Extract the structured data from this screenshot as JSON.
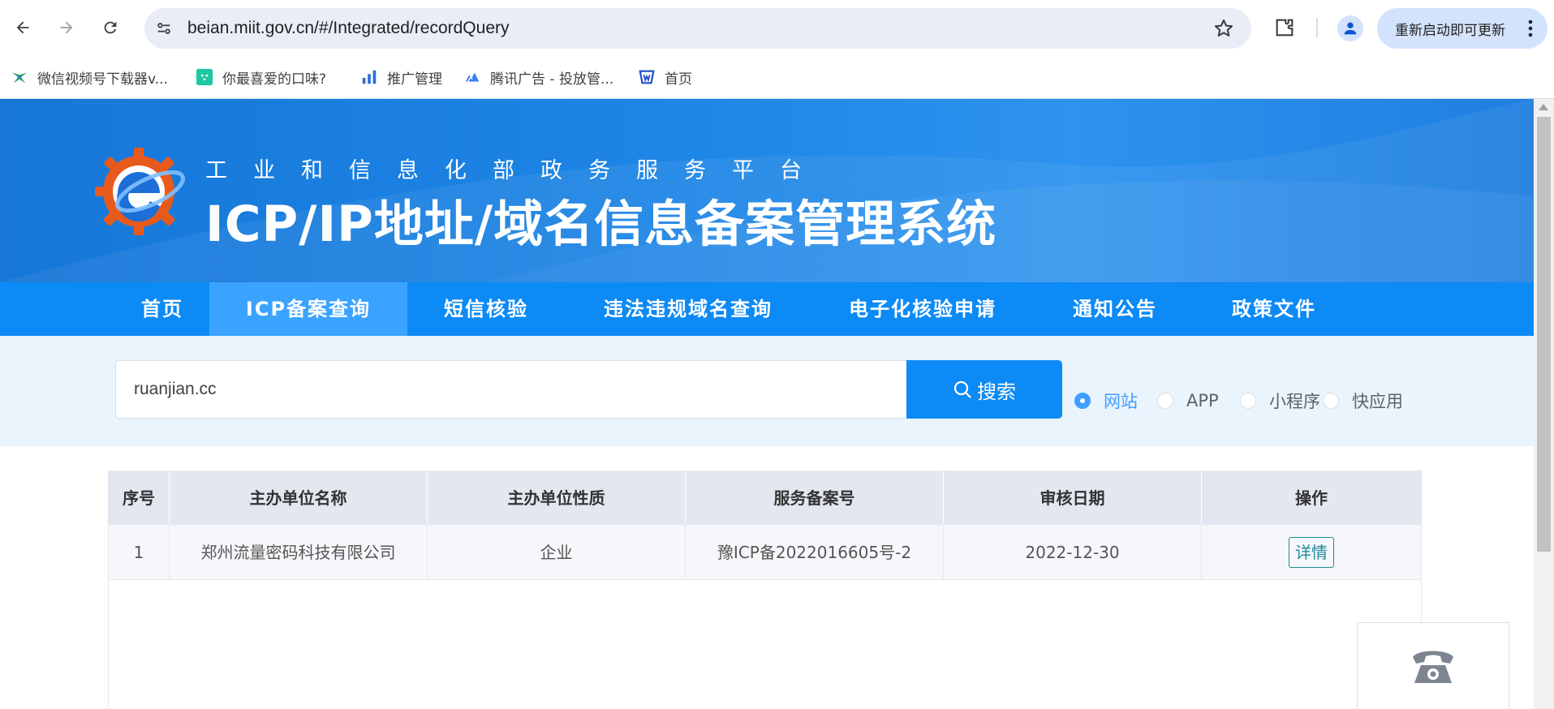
{
  "browser": {
    "url": "beian.miit.gov.cn/#/Integrated/recordQuery",
    "update_label": "重新启动即可更新",
    "bookmarks": [
      {
        "label": "微信视频号下载器v..."
      },
      {
        "label": "你最喜爱的口味?"
      },
      {
        "label": "推广管理"
      },
      {
        "label": "腾讯广告 - 投放管..."
      },
      {
        "label": "首页"
      }
    ]
  },
  "banner": {
    "subtitle": "工业和信息化部政务服务平台",
    "title": "ICP/IP地址/域名信息备案管理系统"
  },
  "nav": {
    "items": [
      {
        "label": "首页"
      },
      {
        "label": "ICP备案查询",
        "active": true
      },
      {
        "label": "短信核验"
      },
      {
        "label": "违法违规域名查询"
      },
      {
        "label": "电子化核验申请"
      },
      {
        "label": "通知公告"
      },
      {
        "label": "政策文件"
      }
    ]
  },
  "search": {
    "value": "ruanjian.cc",
    "button_label": "搜索",
    "types": [
      {
        "label": "网站",
        "checked": true
      },
      {
        "label": "APP"
      },
      {
        "label": "小程序"
      },
      {
        "label": "快应用"
      }
    ]
  },
  "table": {
    "headers": [
      "序号",
      "主办单位名称",
      "主办单位性质",
      "服务备案号",
      "审核日期",
      "操作"
    ],
    "rows": [
      {
        "index": "1",
        "org_name": "郑州流量密码科技有限公司",
        "org_type": "企业",
        "record_no": "豫ICP备2022016605号-2",
        "audit_date": "2022-12-30",
        "action": "详情"
      }
    ]
  },
  "colors": {
    "nav_bg": "#0c8af5",
    "nav_active": "#3aa3ff",
    "radio_checked": "#409eff",
    "detail_btn": "#1f8a99"
  }
}
